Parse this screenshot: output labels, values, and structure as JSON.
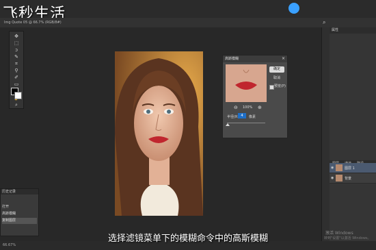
{
  "watermark": "飞秒生活",
  "doc_tab": "Img Quote 05 @ 66.7% (RGB/8#)",
  "filter_dialog": {
    "title": "高斯模糊",
    "close": "×",
    "ok": "确定",
    "cancel": "取消",
    "preview_label": "预览(P)",
    "zoom_out": "⊖",
    "zoom_value": "100%",
    "zoom_in": "⊕",
    "radius_label": "半径(R):",
    "radius_value": "4",
    "radius_unit": "像素"
  },
  "panels": {
    "properties_title": "属性",
    "layers_tabs": [
      "图层",
      "通道",
      "路径"
    ],
    "layers": [
      {
        "name": "图层 1"
      },
      {
        "name": "背景"
      }
    ]
  },
  "history": {
    "title": "历史记录",
    "items": [
      {
        "label": "打开"
      },
      {
        "label": "高斯模糊"
      },
      {
        "label": "复制图层"
      }
    ]
  },
  "status": {
    "zoom": "66.67%"
  },
  "subtitle": "选择滤镜菜单下的模糊命令中的高斯模糊",
  "windows_notice": {
    "line1": "激活 Windows",
    "line2": "转到\"设置\"以激活 Windows。"
  },
  "colors": {
    "accent": "#1e6fc8",
    "cloud": "#3aa0ff",
    "lips": "#c0262e"
  }
}
